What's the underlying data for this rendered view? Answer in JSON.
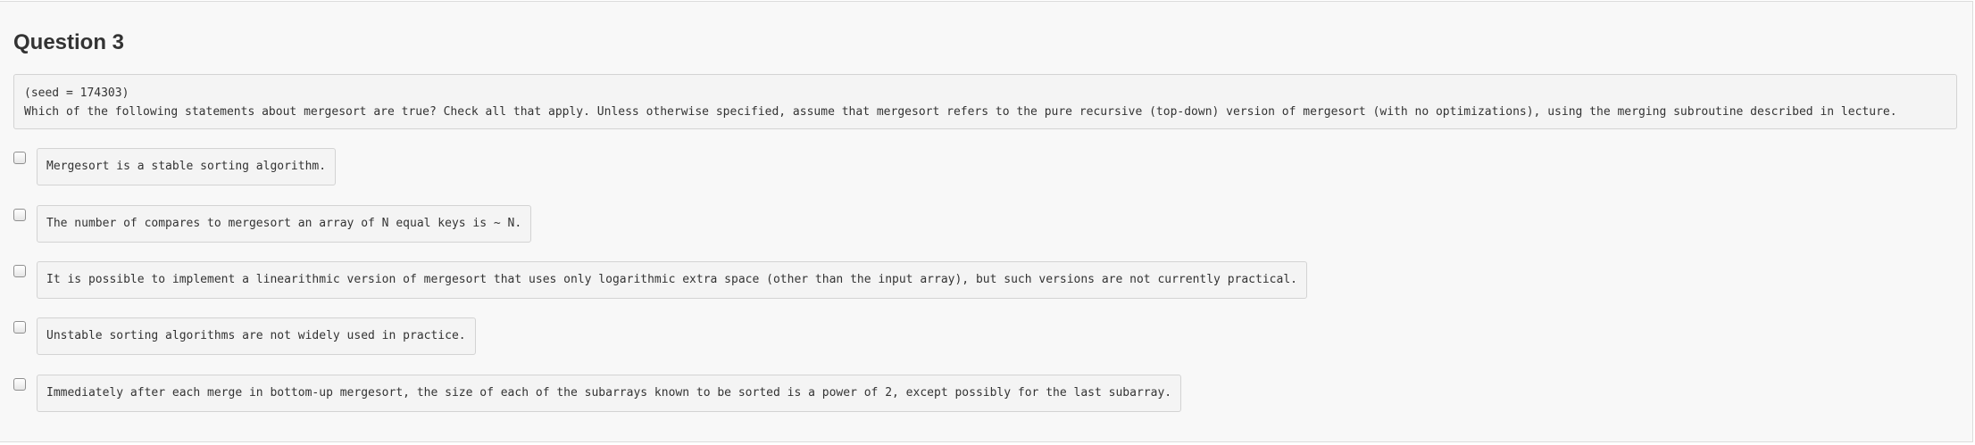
{
  "question": {
    "title": "Question 3",
    "seed_line": "(seed = 174303)",
    "prompt": "Which of the following statements about mergesort are true? Check all that apply. Unless otherwise specified, assume that mergesort refers to the pure recursive (top-down) version of mergesort (with no optimizations), using the merging subroutine described in lecture."
  },
  "options": [
    {
      "text": "Mergesort is a stable sorting algorithm.",
      "checked": false
    },
    {
      "text": "The number of compares to mergesort an array of N equal keys is ~ N.",
      "checked": false
    },
    {
      "text": "It is possible to implement a linearithmic version of mergesort that uses only logarithmic extra space (other than the input array), but such versions are not currently practical.",
      "checked": false
    },
    {
      "text": "Unstable sorting algorithms are not widely used in practice.",
      "checked": false
    },
    {
      "text": "Immediately after each merge in bottom-up mergesort, the size of each of the subarrays known to be sorted is a power of 2, except possibly for the last subarray.",
      "checked": false
    }
  ]
}
